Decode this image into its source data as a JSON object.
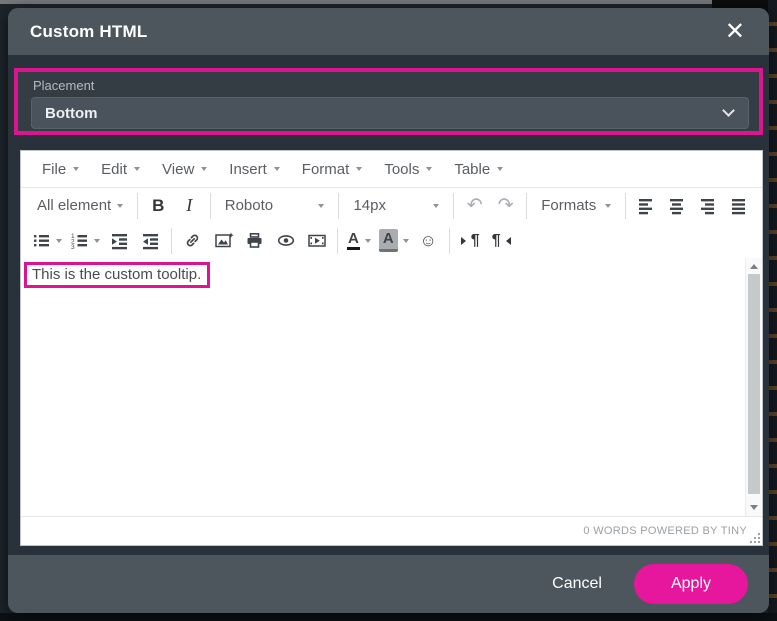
{
  "dialog": {
    "title": "Custom HTML",
    "close_icon": "✕"
  },
  "placement": {
    "label": "Placement",
    "value": "Bottom"
  },
  "editor": {
    "menu": [
      "File",
      "Edit",
      "View",
      "Insert",
      "Format",
      "Tools",
      "Table"
    ],
    "toolbar": {
      "element_path": "All element",
      "bold": "B",
      "italic": "I",
      "font_family": "Roboto",
      "font_size": "14px",
      "undo": "↶",
      "redo": "↷",
      "formats": "Formats",
      "text_color_letter": "A",
      "back_color_letter": "A",
      "emoticon": "☺",
      "ltr_pilcrow": "¶",
      "rtl_pilcrow": "¶"
    },
    "content_text": "This is the custom tooltip.",
    "status_text": "0 WORDS POWERED BY TINY"
  },
  "footer": {
    "cancel_label": "Cancel",
    "apply_label": "Apply"
  },
  "colors": {
    "accent_pink": "#dd1490",
    "apply_button_pink": "#e6179c",
    "header_gray": "#4d565d",
    "body_dark": "#29323a",
    "placement_inner": "#343d44",
    "select_bg": "#4a535b",
    "editor_bg": "#ffffff"
  }
}
